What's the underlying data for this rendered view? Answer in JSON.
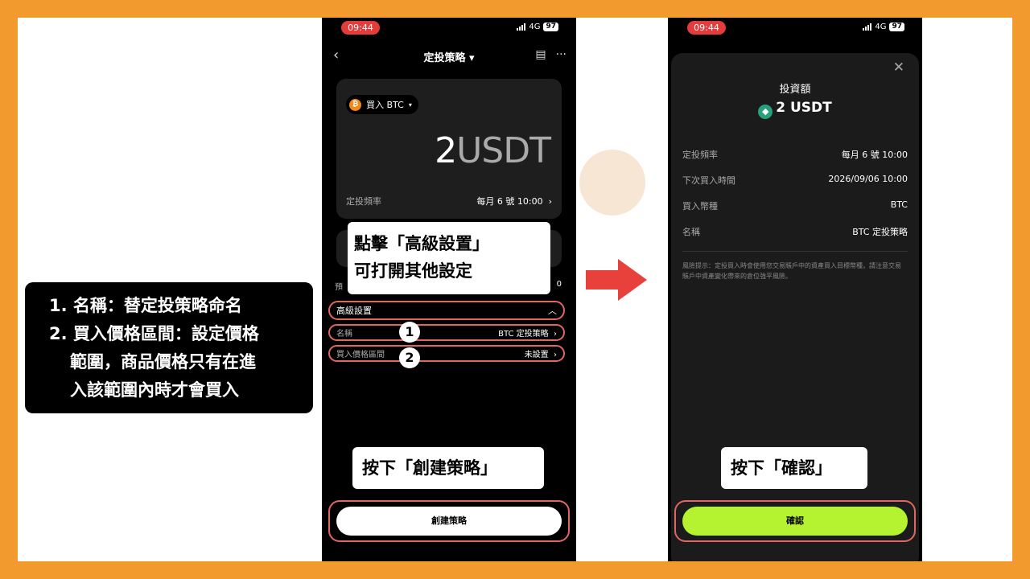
{
  "note": {
    "line1": "1. 名稱：替定投策略命名",
    "line2": "2. 買入價格區間：設定價格",
    "line3": "範圍，商品價格只有在進",
    "line4": "入該範圍內時才會買入"
  },
  "phone1": {
    "status": {
      "time": "09:44",
      "network": "4G",
      "battery": "97"
    },
    "title": "定投策略",
    "buy_label": "買入 BTC",
    "amount_number": "2",
    "amount_unit": "USDT",
    "freq_label": "定投頻率",
    "freq_value": "每月 6 號 10:00",
    "pre_label": "預",
    "pre_value": "0",
    "callout_top_line1": "點擊「高級設置」",
    "callout_top_line2": "可打開其他設定",
    "advanced_label": "高級設置",
    "name_label": "名稱",
    "name_value": "BTC 定投策略",
    "price_range_label": "買入價格區間",
    "price_range_value": "未設置",
    "badge1": "1",
    "badge2": "2",
    "callout_bottom": "按下「創建策略」",
    "create_button": "創建策略"
  },
  "phone2": {
    "status": {
      "time": "09:44",
      "network": "4G",
      "battery": "97"
    },
    "sheet_title": "投資額",
    "amount": "2 USDT",
    "rows": [
      {
        "label": "定投頻率",
        "value": "每月 6 號 10:00"
      },
      {
        "label": "下次買入時間",
        "value": "2026/09/06 10:00"
      },
      {
        "label": "買入幣種",
        "value": "BTC"
      },
      {
        "label": "名稱",
        "value": "BTC 定投策略"
      }
    ],
    "risk_text": "風險提示：定投買入時會使用您交易賬戶中的資產買入目標幣種，請注意交易賬戶中資產變化帶來的倉位強平風險。",
    "callout": "按下「確認」",
    "confirm_button": "確認"
  },
  "colors": {
    "frame": "#f29a2e",
    "highlight": "#e06666",
    "confirm": "#b5f230",
    "btc": "#f0891c",
    "usdt": "#26a17b"
  }
}
